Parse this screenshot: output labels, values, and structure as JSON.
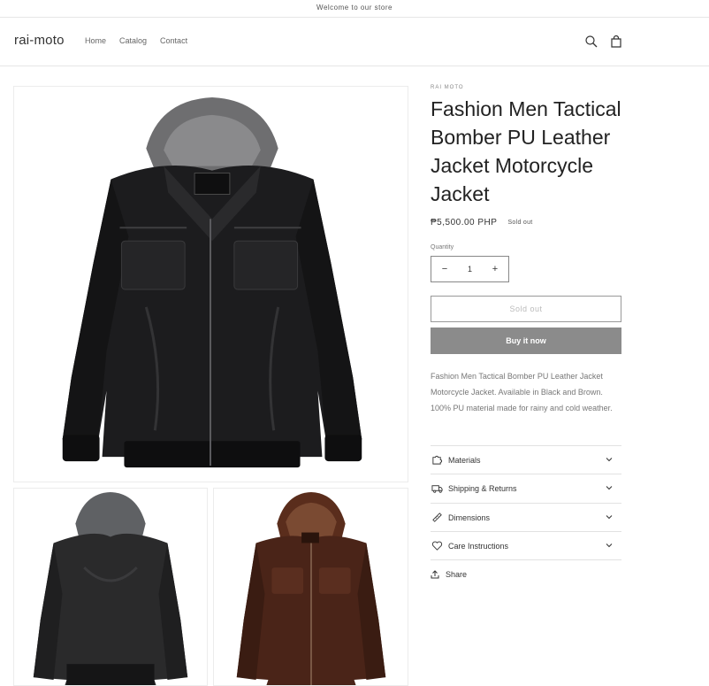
{
  "announcement": "Welcome to our store",
  "header": {
    "logo": "rai-moto",
    "nav": [
      "Home",
      "Catalog",
      "Contact"
    ],
    "icons": [
      "search-icon",
      "cart-icon"
    ]
  },
  "product": {
    "vendor": "RAI MOTO",
    "title": "Fashion Men Tactical Bomber PU Leather Jacket Motorcycle Jacket",
    "price": "₱5,500.00 PHP",
    "badge": "Sold out",
    "quantity_label": "Quantity",
    "quantity": "1",
    "decrease": "−",
    "increase": "+",
    "soldout_button": "Sold out",
    "buy_button": "Buy it now",
    "description": "Fashion Men Tactical Bomber PU Leather Jacket Motorcycle Jacket. Available in Black and Brown. 100% PU material made for rainy and cold weather.",
    "accordions": [
      {
        "label": "Materials",
        "icon": "puzzle-icon"
      },
      {
        "label": "Shipping & Returns",
        "icon": "truck-icon"
      },
      {
        "label": "Dimensions",
        "icon": "ruler-icon"
      },
      {
        "label": "Care Instructions",
        "icon": "heart-icon"
      }
    ],
    "share": "Share"
  },
  "media": [
    {
      "name": "black-jacket-front",
      "color": "#1c1c1e"
    },
    {
      "name": "black-jacket-back",
      "color": "#2a2a2b"
    },
    {
      "name": "brown-jacket-front",
      "color": "#4a2418"
    }
  ]
}
